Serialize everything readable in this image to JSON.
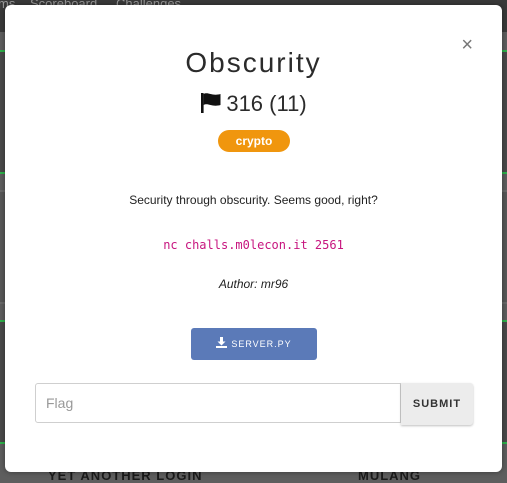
{
  "background": {
    "nav": [
      "ms",
      "Scoreboard",
      "Challenges"
    ],
    "bottom_labels": [
      "YET ANOTHER LOGIN",
      "MULANG"
    ]
  },
  "modal": {
    "title": "Obscurity",
    "points": "316",
    "solves": "(11)",
    "category": "crypto",
    "description": "Security through obscurity. Seems good, right?",
    "command": "nc challs.m0lecon.it 2561",
    "author": "Author: mr96",
    "download_label": "SERVER.PY",
    "flag_placeholder": "Flag",
    "submit_label": "SUBMIT",
    "close_symbol": "×"
  },
  "colors": {
    "accent_badge": "#f0960e",
    "download_button": "#5b7ab8",
    "command_text": "#c7157f",
    "card_border": "#2db34a"
  },
  "icons": [
    "flag-icon",
    "download-icon",
    "close-icon"
  ]
}
